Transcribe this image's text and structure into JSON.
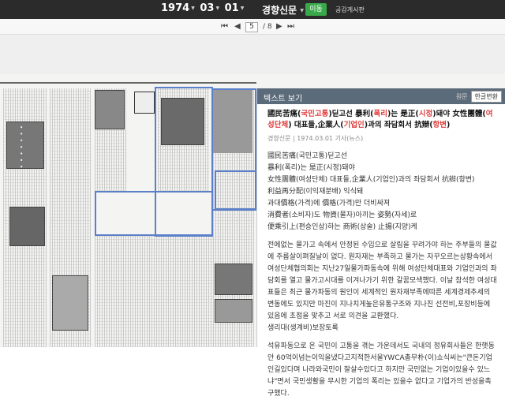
{
  "topbar": {
    "year": "1974",
    "month": "03",
    "day": "01",
    "publication": "경향신문",
    "move_button": "이동",
    "board_link": "공감게시판"
  },
  "pager": {
    "current": "5",
    "separator": "/",
    "total": "8"
  },
  "panel": {
    "title": "텍스트 보기",
    "toggle_original": "원문",
    "toggle_korean": "한글변환",
    "article_title_a": "國民苦痛(",
    "article_title_b": "국민고통",
    "article_title_c": ")딛고선 暴利(",
    "article_title_d": "폭리",
    "article_title_e": ")는 是正(",
    "article_title_f": "시정",
    "article_title_g": ")돼야 女性團體(",
    "article_title_h": "여성단체",
    "article_title_i": ") 대표들,企業人(",
    "article_title_j": "기업인",
    "article_title_k": ")과의 좌담회서 抗辯(",
    "article_title_l": "항변",
    "article_title_m": ")",
    "meta": "경향신문 | 1974.03.01 기사(뉴스)",
    "line1": "國民苦痛(국민고통)딛고선",
    "line2": "暴利(폭리)는 是正(시정)돼야",
    "line3": "女性團體(여성단체) 대표들,企業人(기업인)과의 좌담회서 抗辯(항변)",
    "line4": "利益再分配(이익재분배) 익식돼",
    "line5": "과대價格(가격)에 價格(가격)만 더비싸져",
    "line6": "消費者(소비자)도 物資(물자)아끼는 姿勢(자세)로",
    "line7": "便乘引上(편승인상)하는 商術(상술) 止揚(지양)케",
    "para1": "전에없는 물가고 속에서 안정된 수입으로 살림을 꾸려가야 하는 주부들의 물값에 주름살이펴질날이 없다. 원자재는 부족하고 물가는 자꾸오르는상황속에서 여성단체협의회는 지난27일물가파동속에 위해 여성단체대표와 기업인과의 좌담회를 열고 물가고시대를 이겨나가기 위한 갈꿈모색했다. 이날 참석한 여성대표들은 최근 물가파동의 원인이 세계적인 원자재부족에따른 세계경제추세의 변동에도 있지만 마진이 지나치게높은유통구조와 지나친 선전비,포장비등에 있음에 초점을 맞추고 서로 의견을 교환했다.",
    "para1b": "생리대(생계비)보장토록",
    "para2": "석유파동으로 온 국민이 고통을 겪는 가운데서도 국내의 정유회사들은 한햇동안 60억이넘는이익을냈다고지적한서울YWCA총무朴(이)쇼식씨는\"큰돈기업인길있다며 나라와국민이 잘살수있다고 하지만 국민없는 기업이있을수 있느냐\"면서 국민생활을 무시한 기업의 폭리는 있을수 없다고 기업가의 반성을촉구했다."
  }
}
